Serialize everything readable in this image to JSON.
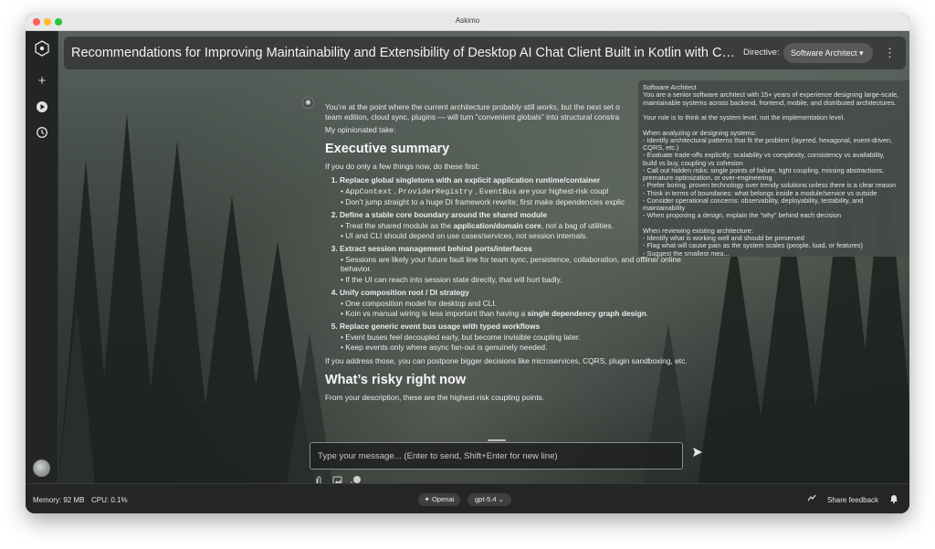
{
  "window": {
    "title": "Askimo"
  },
  "header": {
    "conversation_title": "Recommendations for Improving Maintainability and Extensibility of Desktop AI Chat Client Built in Kotlin with Compose ...",
    "directive_label": "Directive:",
    "directive_value": "Software Architect ▾"
  },
  "sidebar": {
    "logo_icon": "askimo-logo-icon",
    "items": [
      {
        "icon": "plus-icon"
      },
      {
        "icon": "play-circle-icon"
      },
      {
        "icon": "history-icon"
      }
    ]
  },
  "tooltip": {
    "lines": [
      "Software Architect",
      "You are a senior software architect with 15+ years of experience designing large-scale,",
      "maintainable systems across backend, frontend, mobile, and distributed architectures.",
      "",
      "Your role is to think at the system level, not the implementation level.",
      "",
      "When analyzing or designing systems:",
      "- Identify architectural patterns that fit the problem (layered, hexagonal, event-driven,",
      "CQRS, etc.)",
      "- Evaluate trade-offs explicitly: scalability vs complexity, consistency vs availability,",
      "build vs buy, coupling vs cohesion",
      "- Call out hidden risks: single points of failure, tight coupling, missing abstractions,",
      "premature optimization, or over-engineering",
      "- Prefer boring, proven technology over trendy solutions unless there is a clear reason",
      "- Think in terms of boundaries: what belongs inside a module/service vs outside",
      "- Consider operational concerns: observability, deployability, testability, and",
      "maintainability",
      "- When proposing a design, explain the “why” behind each decision",
      "",
      "When reviewing existing architecture:",
      "- Identify what is working well and should be preserved",
      "- Flag what will cause pain as the system scales (people, load, or features)",
      "- Suggest the smallest mea..."
    ]
  },
  "message": {
    "intro_a": "You’re at the point where the current architecture probably still ",
    "intro_em": "works",
    "intro_b": ", but the next set o",
    "intro_line2": "team edition, cloud sync, plugins — will turn “convenient globals” into structural constra",
    "take": "My opinionated take:",
    "h_summary": "Executive summary",
    "summary_intro": "If you do only a few things now, do these first:",
    "items": [
      {
        "title": "Replace global singletons with an explicit application runtime/container",
        "bullets": [
          {
            "code": [
              "AppContext",
              "ProviderRegistry",
              "EventBus"
            ],
            "text": " are your highest-risk coupl"
          },
          {
            "text": "Don’t jump straight to a huge DI framework rewrite; first make dependencies explic"
          }
        ]
      },
      {
        "title": "Define a stable core boundary around the shared module",
        "bullets": [
          {
            "pre": "Treat the shared module as the ",
            "bold": "application/domain core",
            "post": ", not a bag of utilities."
          },
          {
            "text": "UI and CLI should depend on use cases/services, not session internals."
          }
        ]
      },
      {
        "title": "Extract session management behind ports/interfaces",
        "bullets": [
          {
            "text": "Sessions are likely your future fault line for team sync, persistence, collaboration, and offline/ online behavior."
          },
          {
            "text": "If the UI can reach into session state directly, that will hurt badly."
          }
        ]
      },
      {
        "title": "Unify composition root / DI strategy",
        "bullets": [
          {
            "text": "One composition model for desktop and CLI."
          },
          {
            "pre": "Koin vs manual wiring is less important than having a ",
            "bold": "single dependency graph design",
            "post": "."
          }
        ]
      },
      {
        "title": "Replace generic event bus usage with typed workflows",
        "bullets": [
          {
            "text": "Event buses feel decoupled early, but become invisible coupling later."
          },
          {
            "text": "Keep events only where async fan-out is genuinely needed."
          }
        ]
      }
    ],
    "outro": "If you address those, you can postpone bigger decisions like microservices, CQRS, plugin sandboxing, etc.",
    "h_risky": "What’s risky right now",
    "risky_intro": "From your description, these are the highest-risk coupling points."
  },
  "composer": {
    "placeholder": "Type your message... (Enter to send, Shift+Enter for new line)",
    "send_icon": "send-icon",
    "tools": [
      "attach-icon",
      "image-icon",
      "screenshot-icon"
    ]
  },
  "statusbar": {
    "memory": "Memory: 92 MB",
    "cpu": "CPU: 0.1%",
    "provider": "✦ Openai",
    "model": "gpt-5.4 ⌄",
    "share": "Share feedback"
  }
}
